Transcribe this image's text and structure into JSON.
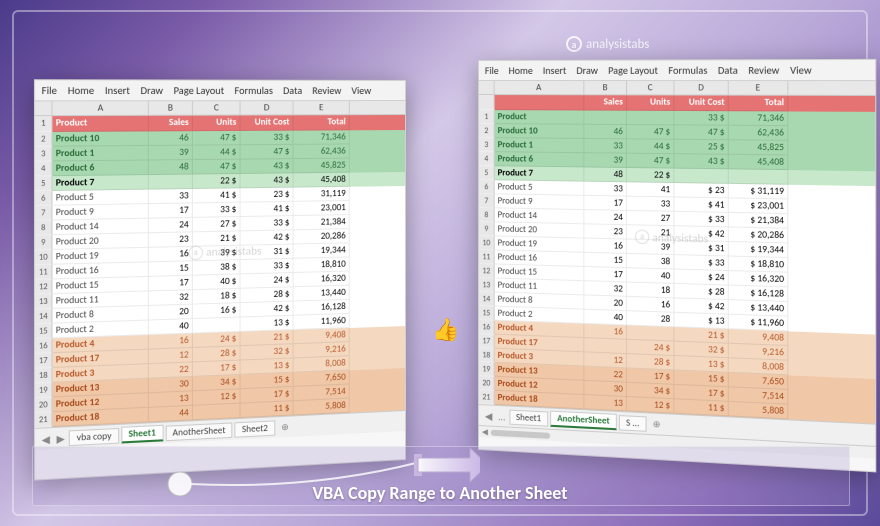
{
  "watermark": "analysistabs",
  "caption": "VBA Copy Range to Another Sheet",
  "ribbon_tabs": [
    "File",
    "Home",
    "Insert",
    "Draw",
    "Page Layout",
    "Formulas",
    "Data",
    "Review",
    "View"
  ],
  "columns": [
    "A",
    "B",
    "C",
    "D",
    "E"
  ],
  "header": {
    "product": "Product",
    "sales": "Sales",
    "units": "Units",
    "unit_cost": "Unit Cost",
    "total": "Total"
  },
  "left": {
    "rows": [
      {
        "n": 2,
        "cls": "g1",
        "p": "Product 10",
        "s": "46",
        "u": "47 $",
        "c": "33 $",
        "t": "71,346"
      },
      {
        "n": 3,
        "cls": "g1",
        "p": "Product 1",
        "s": "39",
        "u": "44 $",
        "c": "47 $",
        "t": "62,436"
      },
      {
        "n": 4,
        "cls": "g1",
        "p": "Product 6",
        "s": "48",
        "u": "47 $",
        "c": "43 $",
        "t": "45,825"
      },
      {
        "n": 5,
        "cls": "g2",
        "p": "Product 7",
        "s": "",
        "u": "22 $",
        "c": "43 $",
        "t": "45,408"
      },
      {
        "n": 6,
        "cls": "plain",
        "p": "Product 5",
        "s": "33",
        "u": "41 $",
        "c": "23 $",
        "t": "31,119"
      },
      {
        "n": 7,
        "cls": "plain",
        "p": "Product 9",
        "s": "17",
        "u": "33 $",
        "c": "41 $",
        "t": "23,001"
      },
      {
        "n": 8,
        "cls": "plain",
        "p": "Product 14",
        "s": "24",
        "u": "27 $",
        "c": "33 $",
        "t": "21,384"
      },
      {
        "n": 9,
        "cls": "plain",
        "p": "Product 20",
        "s": "23",
        "u": "21 $",
        "c": "42 $",
        "t": "20,286"
      },
      {
        "n": 10,
        "cls": "plain",
        "p": "Product 19",
        "s": "16",
        "u": "39 $",
        "c": "31 $",
        "t": "19,344"
      },
      {
        "n": 11,
        "cls": "plain",
        "p": "Product 16",
        "s": "15",
        "u": "38 $",
        "c": "33 $",
        "t": "18,810"
      },
      {
        "n": 12,
        "cls": "plain",
        "p": "Product 15",
        "s": "17",
        "u": "40 $",
        "c": "24 $",
        "t": "16,320"
      },
      {
        "n": 13,
        "cls": "plain",
        "p": "Product 11",
        "s": "32",
        "u": "18 $",
        "c": "28 $",
        "t": "13,440"
      },
      {
        "n": 14,
        "cls": "plain",
        "p": "Product 8",
        "s": "20",
        "u": "16 $",
        "c": "42 $",
        "t": "16,128"
      },
      {
        "n": 15,
        "cls": "plain",
        "p": "Product 2",
        "s": "40",
        "u": "",
        "c": "13 $",
        "t": "11,960"
      },
      {
        "n": 16,
        "cls": "o1",
        "p": "Product 4",
        "s": "16",
        "u": "24 $",
        "c": "21 $",
        "t": "9,408"
      },
      {
        "n": 17,
        "cls": "o1",
        "p": "Product 17",
        "s": "12",
        "u": "28 $",
        "c": "32 $",
        "t": "9,216"
      },
      {
        "n": 18,
        "cls": "o1",
        "p": "Product 3",
        "s": "22",
        "u": "17 $",
        "c": "13 $",
        "t": "8,008"
      },
      {
        "n": 19,
        "cls": "o2",
        "p": "Product 13",
        "s": "30",
        "u": "34 $",
        "c": "15 $",
        "t": "7,650"
      },
      {
        "n": 20,
        "cls": "o2",
        "p": "Product 12",
        "s": "13",
        "u": "12 $",
        "c": "17 $",
        "t": "7,514"
      },
      {
        "n": 21,
        "cls": "o2",
        "p": "Product 18",
        "s": "44",
        "u": "",
        "c": "11 $",
        "t": "5,808"
      }
    ],
    "tabs": [
      {
        "label": "vba copy",
        "active": false
      },
      {
        "label": "Sheet1",
        "active": true
      },
      {
        "label": "AnotherSheet",
        "active": false
      },
      {
        "label": "Sheet2",
        "active": false
      }
    ]
  },
  "right": {
    "rows": [
      {
        "n": 1,
        "cls": "hdrrow",
        "p": "Product",
        "s": "",
        "u": "",
        "c": "33 $",
        "t": "71,346"
      },
      {
        "n": 2,
        "cls": "g1",
        "p": "Product 10",
        "s": "46",
        "u": "47 $",
        "c": "47 $",
        "t": "62,436"
      },
      {
        "n": 3,
        "cls": "g1",
        "p": "Product 1",
        "s": "33",
        "u": "44 $",
        "c": "25 $",
        "t": "45,825"
      },
      {
        "n": 4,
        "cls": "g1",
        "p": "Product 6",
        "s": "39",
        "u": "47 $",
        "c": "43 $",
        "t": "45,408"
      },
      {
        "n": 5,
        "cls": "g2",
        "p": "Product 7",
        "s": "48",
        "u": "22 $",
        "c": "",
        "t": ""
      },
      {
        "n": 6,
        "cls": "plain",
        "p": "Product 5",
        "s": "33",
        "u": "41",
        "c": "$  23",
        "t": "$  31,119"
      },
      {
        "n": 7,
        "cls": "plain",
        "p": "Product 9",
        "s": "17",
        "u": "33",
        "c": "$  41",
        "t": "$  23,001"
      },
      {
        "n": 8,
        "cls": "plain",
        "p": "Product 14",
        "s": "24",
        "u": "27",
        "c": "$  33",
        "t": "$  21,384"
      },
      {
        "n": 9,
        "cls": "plain",
        "p": "Product 20",
        "s": "23",
        "u": "21",
        "c": "$  42",
        "t": "$  20,286"
      },
      {
        "n": 10,
        "cls": "plain",
        "p": "Product 19",
        "s": "16",
        "u": "39",
        "c": "$  31",
        "t": "$  19,344"
      },
      {
        "n": 11,
        "cls": "plain",
        "p": "Product 16",
        "s": "15",
        "u": "38",
        "c": "$  33",
        "t": "$  18,810"
      },
      {
        "n": 12,
        "cls": "plain",
        "p": "Product 15",
        "s": "17",
        "u": "40",
        "c": "$  24",
        "t": "$  16,320"
      },
      {
        "n": 13,
        "cls": "plain",
        "p": "Product 11",
        "s": "32",
        "u": "18",
        "c": "$  28",
        "t": "$  16,128"
      },
      {
        "n": 14,
        "cls": "plain",
        "p": "Product 8",
        "s": "20",
        "u": "16",
        "c": "$  42",
        "t": "$  13,440"
      },
      {
        "n": 15,
        "cls": "plain",
        "p": "Product 2",
        "s": "40",
        "u": "28",
        "c": "$  13",
        "t": "$  11,960"
      },
      {
        "n": 16,
        "cls": "o1",
        "p": "Product 4",
        "s": "16",
        "u": "",
        "c": "21 $",
        "t": "9,408"
      },
      {
        "n": 17,
        "cls": "o1",
        "p": "Product 17",
        "s": "",
        "u": "24 $",
        "c": "32 $",
        "t": "9,216"
      },
      {
        "n": 18,
        "cls": "o1",
        "p": "Product 3",
        "s": "12",
        "u": "28 $",
        "c": "13 $",
        "t": "8,008"
      },
      {
        "n": 19,
        "cls": "o2",
        "p": "Product 13",
        "s": "22",
        "u": "17 $",
        "c": "15 $",
        "t": "7,650"
      },
      {
        "n": 20,
        "cls": "o2",
        "p": "Product 12",
        "s": "30",
        "u": "34 $",
        "c": "17 $",
        "t": "7,514"
      },
      {
        "n": 21,
        "cls": "o2",
        "p": "Product 18",
        "s": "13",
        "u": "12 $",
        "c": "11 $",
        "t": "5,808"
      }
    ],
    "tabs": [
      {
        "label": "Sheet1",
        "active": false
      },
      {
        "label": "AnotherSheet",
        "active": true
      },
      {
        "label": "S ...",
        "active": false
      }
    ]
  }
}
